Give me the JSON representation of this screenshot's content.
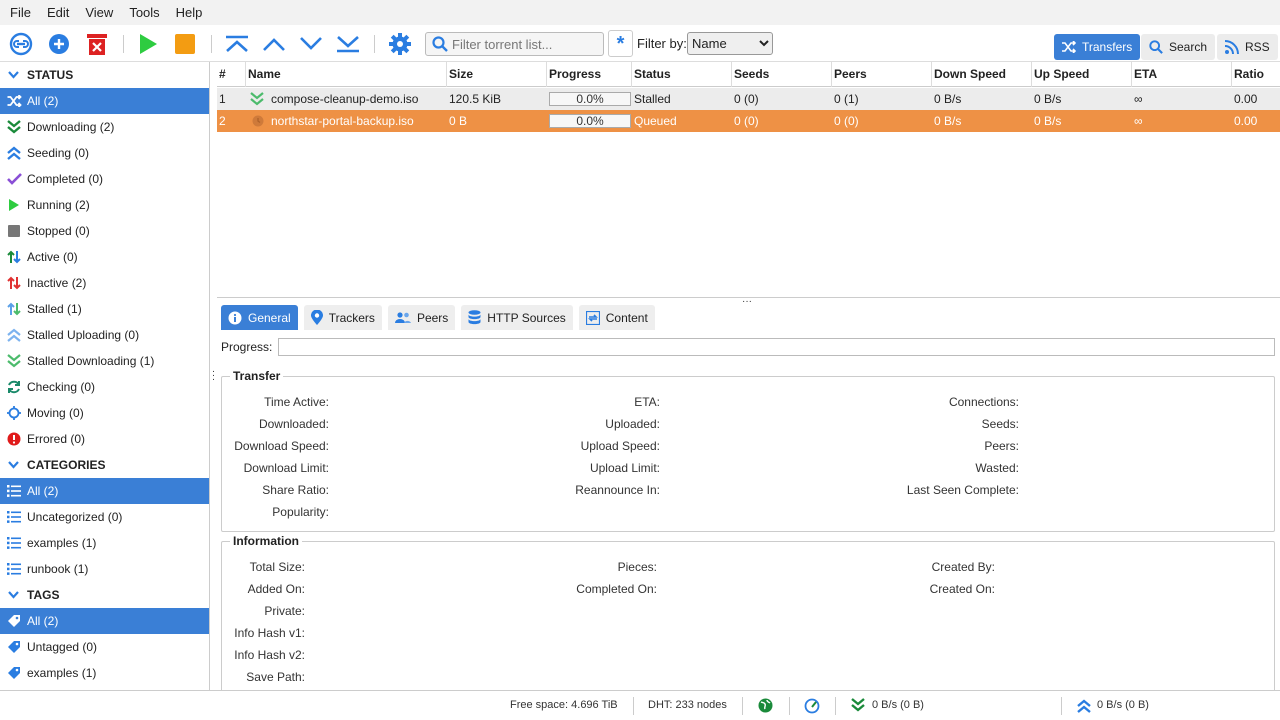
{
  "menu": [
    "File",
    "Edit",
    "View",
    "Tools",
    "Help"
  ],
  "toolbar": {
    "search_placeholder": "Filter torrent list...",
    "regex_label": "*",
    "filter_label": "Filter by:",
    "filter_options": [
      "Name"
    ],
    "filter_value": "Name",
    "view_transfers": "Transfers",
    "view_search": "Search",
    "view_rss": "RSS"
  },
  "sidebar": {
    "status_header": "STATUS",
    "status_items": [
      {
        "label": "All (2)",
        "icon": "shuffle-icon"
      },
      {
        "label": "Downloading (2)",
        "icon": "download-icon"
      },
      {
        "label": "Seeding (0)",
        "icon": "upload-icon"
      },
      {
        "label": "Completed (0)",
        "icon": "check-icon"
      },
      {
        "label": "Running (2)",
        "icon": "play-icon"
      },
      {
        "label": "Stopped (0)",
        "icon": "stop-icon"
      },
      {
        "label": "Active (0)",
        "icon": "active-arrows-icon"
      },
      {
        "label": "Inactive (2)",
        "icon": "inactive-arrows-icon"
      },
      {
        "label": "Stalled (1)",
        "icon": "stalled-arrows-icon"
      },
      {
        "label": "Stalled Uploading (0)",
        "icon": "stalled-upload-icon"
      },
      {
        "label": "Stalled Downloading (1)",
        "icon": "stalled-download-icon"
      },
      {
        "label": "Checking (0)",
        "icon": "refresh-icon"
      },
      {
        "label": "Moving (0)",
        "icon": "crosshair-icon"
      },
      {
        "label": "Errored (0)",
        "icon": "error-icon"
      }
    ],
    "categories_header": "CATEGORIES",
    "category_items": [
      {
        "label": "All (2)"
      },
      {
        "label": "Uncategorized (0)"
      },
      {
        "label": "examples (1)"
      },
      {
        "label": "runbook (1)"
      }
    ],
    "tags_header": "TAGS",
    "tag_items": [
      {
        "label": "All (2)"
      },
      {
        "label": "Untagged (0)"
      },
      {
        "label": "examples (1)"
      }
    ]
  },
  "table": {
    "columns": [
      "#",
      "Name",
      "Size",
      "Progress",
      "Status",
      "Seeds",
      "Peers",
      "Down Speed",
      "Up Speed",
      "ETA",
      "Ratio"
    ],
    "rows": [
      {
        "num": "1",
        "name": "compose-cleanup-demo.iso",
        "size": "120.5 KiB",
        "progress": "0.0%",
        "progress_value": 0,
        "status": "Stalled",
        "seeds": "0 (0)",
        "peers": "0 (1)",
        "down": "0 B/s",
        "up": "0 B/s",
        "eta": "∞",
        "ratio": "0.00",
        "state_icon": "stalled-download-icon"
      },
      {
        "num": "2",
        "name": "northstar-portal-backup.iso",
        "size": "0 B",
        "progress": "0.0%",
        "progress_value": 0,
        "status": "Queued",
        "seeds": "0 (0)",
        "peers": "0 (0)",
        "down": "0 B/s",
        "up": "0 B/s",
        "eta": "∞",
        "ratio": "0.00",
        "state_icon": "queued-icon"
      }
    ]
  },
  "details": {
    "tabs": [
      "General",
      "Trackers",
      "Peers",
      "HTTP Sources",
      "Content"
    ],
    "progress_label": "Progress:",
    "transfer_legend": "Transfer",
    "transfer_col1": [
      "Time Active:",
      "Downloaded:",
      "Download Speed:",
      "Download Limit:",
      "Share Ratio:",
      "Popularity:"
    ],
    "transfer_col2": [
      "ETA:",
      "Uploaded:",
      "Upload Speed:",
      "Upload Limit:",
      "Reannounce In:"
    ],
    "transfer_col3": [
      "Connections:",
      "Seeds:",
      "Peers:",
      "Wasted:",
      "Last Seen Complete:"
    ],
    "info_legend": "Information",
    "info_col1": [
      "Total Size:",
      "Added On:",
      "Private:",
      "Info Hash v1:",
      "Info Hash v2:",
      "Save Path:"
    ],
    "info_col2": [
      "Pieces:",
      "Completed On:"
    ],
    "info_col3": [
      "Created By:",
      "Created On:"
    ]
  },
  "statusbar": {
    "free_space": "Free space: 4.696 TiB",
    "dht": "DHT: 233 nodes",
    "down": "0 B/s (0 B)",
    "up": "0 B/s (0 B)"
  },
  "colors": {
    "accent": "#3a7fd6",
    "selected_row": "#ee9145",
    "green": "#2da94f",
    "orange": "#f39c12",
    "red": "#e03131"
  }
}
